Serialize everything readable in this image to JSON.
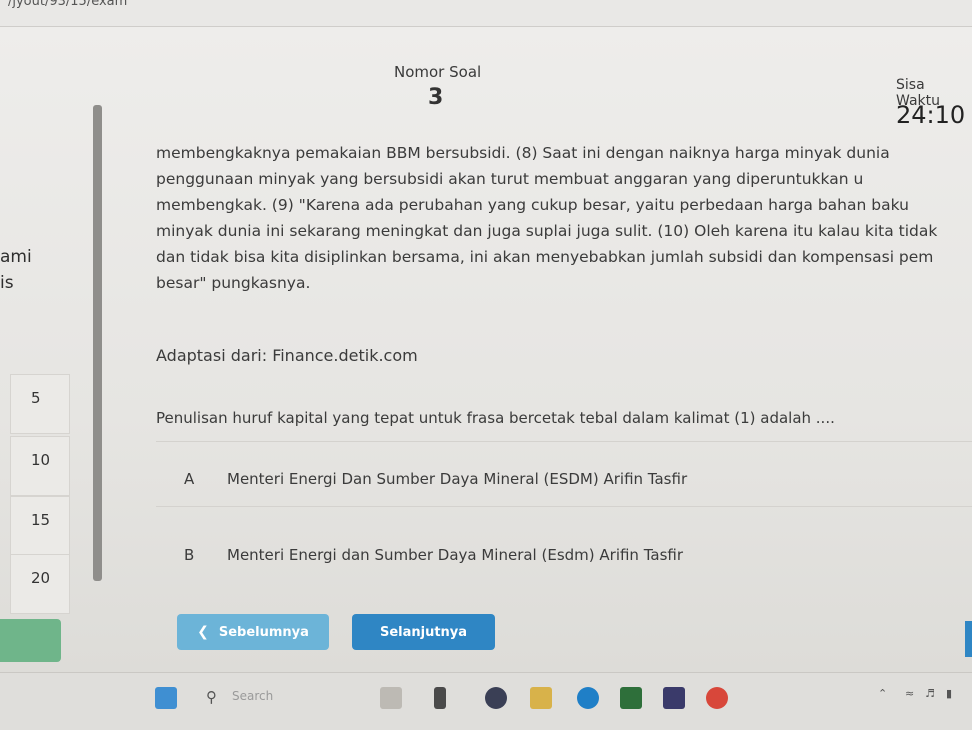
{
  "browser": {
    "url_fragment": "/jyout/93/15/exam"
  },
  "header": {
    "nomor_soal_label": "Nomor Soal",
    "nomor_soal_value": "3",
    "sisa_waktu_label": "Sisa Waktu",
    "sisa_waktu_value": "24:10"
  },
  "passage": {
    "lines": [
      "membengkaknya pemakaian BBM bersubsidi. (8) Saat ini dengan naiknya harga minyak dunia",
      "penggunaan minyak yang bersubsidi akan turut membuat anggaran yang diperuntukkan u",
      "membengkak. (9) \"Karena ada perubahan yang cukup besar, yaitu perbedaan harga bahan baku",
      "minyak dunia ini sekarang meningkat dan juga suplai juga sulit. (10) Oleh karena itu kalau kita tidak",
      "dan tidak bisa kita disiplinkan bersama, ini akan menyebabkan jumlah subsidi dan kompensasi pem",
      "besar\" pungkasnya."
    ],
    "source": "Adaptasi dari: Finance.detik.com"
  },
  "left_panel": {
    "cut_texts": [
      "ami",
      "is"
    ],
    "question_numbers": [
      "5",
      "10",
      "15",
      "20"
    ]
  },
  "question": {
    "text": "Penulisan huruf kapital yang tepat untuk frasa bercetak tebal dalam kalimat (1) adalah ....",
    "options": [
      {
        "letter": "A",
        "text": "Menteri Energi Dan Sumber Daya Mineral (ESDM) Arifin Tasfir"
      },
      {
        "letter": "B",
        "text": "Menteri Energi dan Sumber Daya Mineral (Esdm) Arifin Tasfir"
      }
    ]
  },
  "nav": {
    "prev_label": "Sebelumnya",
    "next_label": "Selanjutnya"
  },
  "taskbar": {
    "search_placeholder": "Search"
  },
  "colors": {
    "prev_button": "#6cb4d8",
    "next_button": "#2f86c4",
    "green_block": "#6fb58a"
  }
}
